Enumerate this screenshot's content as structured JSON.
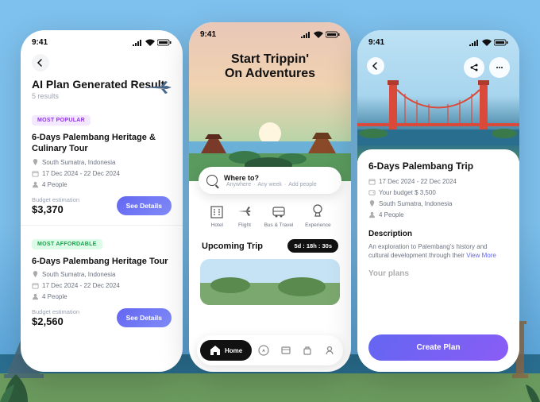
{
  "status": {
    "time": "9:41"
  },
  "screenA": {
    "title": "AI Plan Generated Result",
    "subtitle": "5 results",
    "cards": [
      {
        "badge": "MOST POPULAR",
        "title": "6-Days Palembang Heritage & Culinary Tour",
        "location": "South Sumatra, Indonesia",
        "dates": "17 Dec 2024 - 22 Dec 2024",
        "people": "4 People",
        "budget_label": "Budget estimation",
        "budget": "$3,370",
        "cta": "See Details"
      },
      {
        "badge": "MOST AFFORDABLE",
        "title": "6-Days Palembang Heritage Tour",
        "location": "South Sumatra, Indonesia",
        "dates": "17 Dec 2024 - 22 Dec 2024",
        "people": "4 People",
        "budget_label": "Budget estimation",
        "budget": "$2,560",
        "cta": "See Details"
      }
    ]
  },
  "screenB": {
    "heading_line1": "Start Trippin'",
    "heading_line2": "On Adventures",
    "search": {
      "title": "Where to?",
      "suggestions": [
        "Anywhere",
        "Any week",
        "Add people"
      ]
    },
    "categories": [
      {
        "label": "Hotel"
      },
      {
        "label": "Flight"
      },
      {
        "label": "Bus & Travel"
      },
      {
        "label": "Experience"
      }
    ],
    "upcoming": {
      "title": "Upcoming Trip",
      "countdown": "5d : 18h : 30s"
    },
    "tabs": {
      "home": "Home"
    }
  },
  "screenC": {
    "title": "6-Days Palembang Trip",
    "dates": "17 Dec 2024 - 22 Dec 2024",
    "budget": "Your budget $ 3,500",
    "location": "South Sumatra, Indonesia",
    "people": "4 People",
    "desc_title": "Description",
    "desc_text": "An exploration to Palembang's history and cultural development through their ",
    "view_more": "View More",
    "plans_title": "Your plans",
    "cta": "Create Plan"
  }
}
